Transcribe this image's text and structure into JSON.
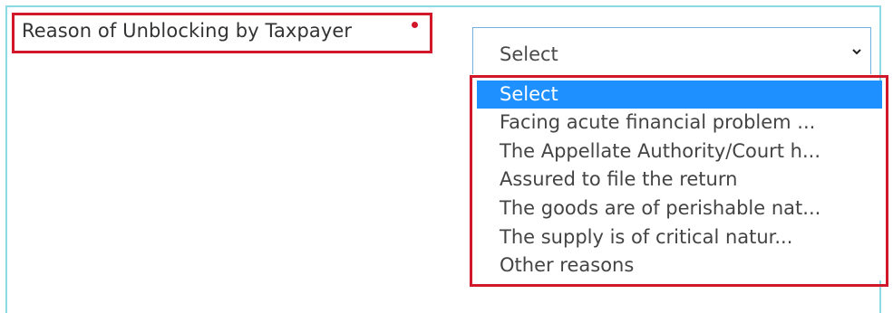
{
  "form": {
    "field_label": "Reason of Unblocking by Taxpayer",
    "required_color": "#d0182a",
    "select": {
      "value": "Select",
      "expanded": true,
      "chevron_icon": "chevron-down-icon"
    },
    "options": [
      {
        "label": "Select",
        "selected": true
      },
      {
        "label": "Facing acute financial problem ...",
        "selected": false
      },
      {
        "label": "The Appellate Authority/Court h...",
        "selected": false
      },
      {
        "label": "Assured to file the return",
        "selected": false
      },
      {
        "label": "The goods are of perishable nat...",
        "selected": false
      },
      {
        "label": "The supply is of critical natur...",
        "selected": false
      },
      {
        "label": "Other reasons",
        "selected": false
      }
    ]
  },
  "colors": {
    "highlight_border": "#d0182a",
    "selected_option_bg": "#1e90ff",
    "select_border": "#6fb2df"
  }
}
